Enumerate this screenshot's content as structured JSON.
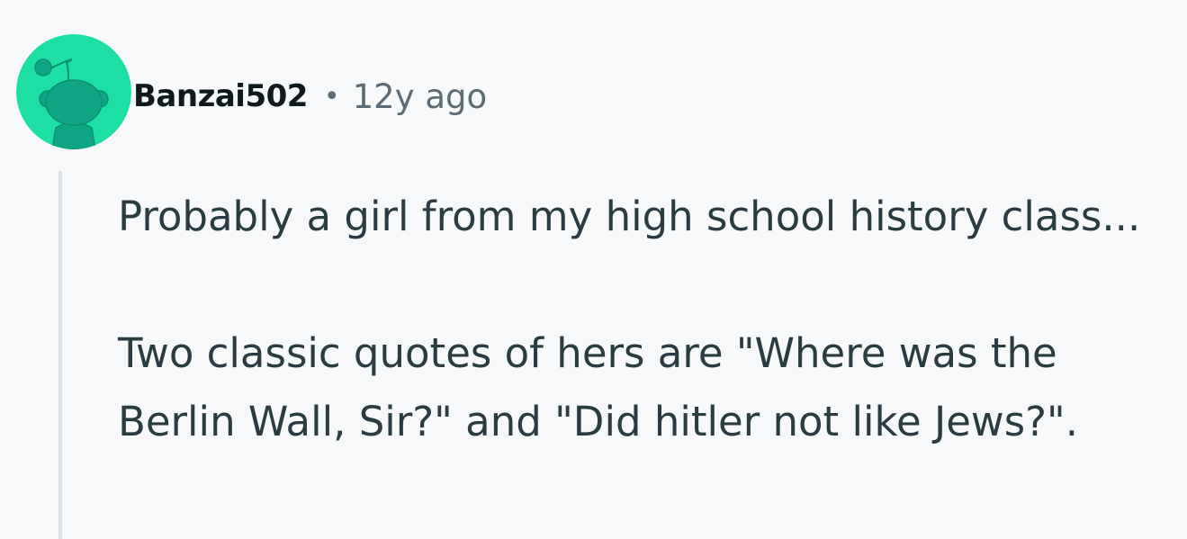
{
  "comment": {
    "author": "Banzai502",
    "separator": "•",
    "timestamp": "12y ago",
    "avatar_icon": "reddit-snoo-avatar-icon",
    "avatar_color": "#1ddfa6",
    "paragraphs": [
      "Probably a girl from my high school history class...",
      "Two classic quotes of hers are \"Where was the Berlin Wall, Sir?\" and \"Did hitler not like Jews?\"."
    ]
  }
}
